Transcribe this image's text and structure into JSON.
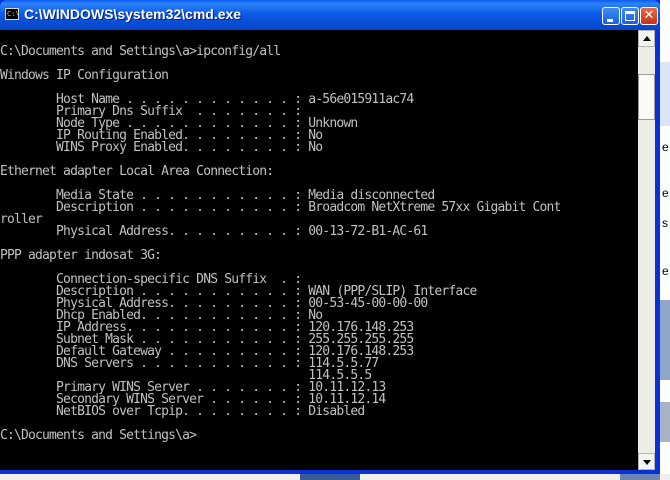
{
  "window": {
    "title": "C:\\WINDOWS\\system32\\cmd.exe",
    "icon_label": "C:\\",
    "buttons": {
      "minimize": "minimize",
      "maximize": "maximize",
      "close": "✕"
    }
  },
  "console": {
    "lines": [
      "C:\\Documents and Settings\\a>ipconfig/all",
      "",
      "Windows IP Configuration",
      "",
      "        Host Name . . . . . . . . . . . . : a-56e015911ac74",
      "        Primary Dns Suffix  . . . . . . . :",
      "        Node Type . . . . . . . . . . . . : Unknown",
      "        IP Routing Enabled. . . . . . . . : No",
      "        WINS Proxy Enabled. . . . . . . . : No",
      "",
      "Ethernet adapter Local Area Connection:",
      "",
      "        Media State . . . . . . . . . . . : Media disconnected",
      "        Description . . . . . . . . . . . : Broadcom NetXtreme 57xx Gigabit Cont",
      "roller",
      "        Physical Address. . . . . . . . . : 00-13-72-B1-AC-61",
      "",
      "PPP adapter indosat 3G:",
      "",
      "        Connection-specific DNS Suffix  . :",
      "        Description . . . . . . . . . . . : WAN (PPP/SLIP) Interface",
      "        Physical Address. . . . . . . . . : 00-53-45-00-00-00",
      "        Dhcp Enabled. . . . . . . . . . . : No",
      "        IP Address. . . . . . . . . . . . : 120.176.148.253",
      "        Subnet Mask . . . . . . . . . . . : 255.255.255.255",
      "        Default Gateway . . . . . . . . . : 120.176.148.253",
      "        DNS Servers . . . . . . . . . . . : 114.5.5.77",
      "                                            114.5.5.5",
      "        Primary WINS Server . . . . . . . : 10.11.12.13",
      "        Secondary WINS Server . . . . . . : 10.11.12.14",
      "        NetBIOS over Tcpip. . . . . . . . : Disabled",
      "",
      "C:\\Documents and Settings\\a>"
    ]
  },
  "background": {
    "edge_letters": [
      "e",
      "e",
      "s",
      "e"
    ]
  },
  "colors": {
    "console_bg": "#000000",
    "console_fg": "#c0c0c0",
    "titlebar": "#0a4fd8",
    "close_button": "#c2351a"
  }
}
